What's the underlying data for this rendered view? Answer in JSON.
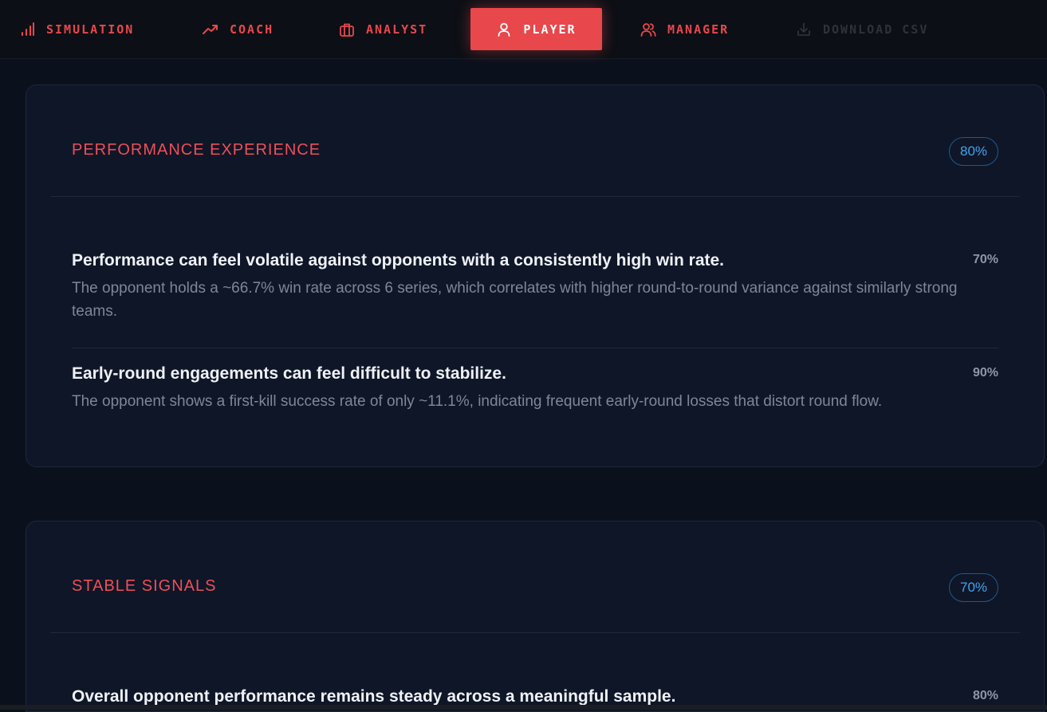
{
  "nav": {
    "tabs": [
      {
        "label": "SIMULATION",
        "icon": "bar-chart-icon"
      },
      {
        "label": "COACH",
        "icon": "trending-up-icon"
      },
      {
        "label": "ANALYST",
        "icon": "briefcase-icon"
      },
      {
        "label": "PLAYER",
        "icon": "user-icon",
        "active": true
      },
      {
        "label": "MANAGER",
        "icon": "users-icon"
      },
      {
        "label": "DOWNLOAD CSV",
        "icon": "download-icon",
        "disabled": true
      }
    ]
  },
  "colors": {
    "accent": "#e8474c",
    "badge": "#3ea4f0",
    "background": "#0b111c",
    "card": "#0f1628"
  },
  "sections": [
    {
      "title": "PERFORMANCE EXPERIENCE",
      "confidence": "80%",
      "items": [
        {
          "title": "Performance can feel volatile against opponents with a consistently high win rate.",
          "pct": "70%",
          "desc": "The opponent holds a ~66.7% win rate across 6 series, which correlates with higher round-to-round variance against similarly strong teams."
        },
        {
          "title": "Early-round engagements can feel difficult to stabilize.",
          "pct": "90%",
          "desc": "The opponent shows a first-kill success rate of only ~11.1%, indicating frequent early-round losses that distort round flow."
        }
      ]
    },
    {
      "title": "STABLE SIGNALS",
      "confidence": "70%",
      "items": [
        {
          "title": "Overall opponent performance remains steady across a meaningful sample.",
          "pct": "80%"
        }
      ]
    }
  ]
}
